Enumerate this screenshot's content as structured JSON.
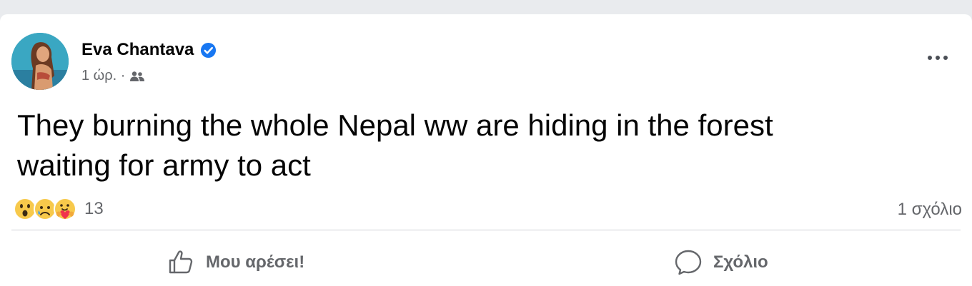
{
  "post": {
    "author": "Eva Chantava",
    "verified": true,
    "time": "1 ώρ. ·",
    "audience_icon": "friends-icon",
    "text_line1": "They burning the whole Nepal ww are hiding in the forest",
    "text_line2": "waiting for army to act"
  },
  "reactions": {
    "icons": [
      "wow-reaction-icon",
      "sad-reaction-icon",
      "care-reaction-icon"
    ],
    "count": "13"
  },
  "comments": {
    "count_label": "1 σχόλιο"
  },
  "actions": {
    "like_label": "Μου αρέσει!",
    "comment_label": "Σχόλιο"
  },
  "colors": {
    "verified_blue": "#1877f2",
    "secondary_text": "#65676b",
    "reaction_yellow": "#f7c94b"
  }
}
